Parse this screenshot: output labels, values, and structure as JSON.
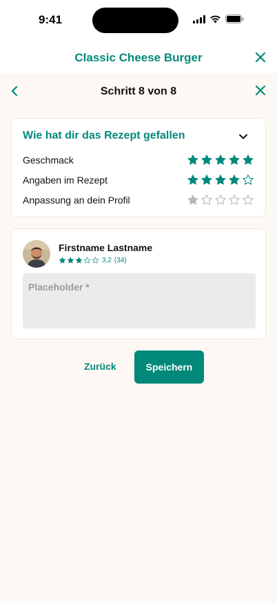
{
  "status_bar": {
    "time": "9:41"
  },
  "header": {
    "title": "Classic Cheese Burger"
  },
  "step_bar": {
    "label": "Schritt 8 von 8"
  },
  "rating": {
    "heading": "Wie hat dir das Rezept gefallen",
    "rows": [
      {
        "label": "Geschmack",
        "stars": 5
      },
      {
        "label": "Angaben im Rezept",
        "stars": 4
      },
      {
        "label": "Anpassung an dein Profil",
        "stars": 1
      }
    ],
    "max_stars": 5
  },
  "review": {
    "user_name": "Firstname Lastname",
    "user_stars": 3,
    "user_score": "3,2",
    "user_count": "(34)",
    "comment_placeholder": "Placeholder *"
  },
  "actions": {
    "back_label": "Zurück",
    "save_label": "Speichern"
  },
  "colors": {
    "accent": "#00897b",
    "background": "#fdf8f3",
    "star_inactive": "#b7b7b7"
  }
}
